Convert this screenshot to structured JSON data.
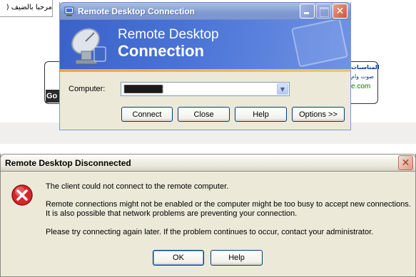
{
  "background_page": {
    "greeting": "مرحبا بالضيف (",
    "google_fragment": "Go",
    "ad_line1": "المناسبات",
    "ad_line2": "صوت وام",
    "ad_line3": "e.com"
  },
  "rdc_window": {
    "title": "Remote Desktop Connection",
    "banner_line1": "Remote Desktop",
    "banner_line2": "Connection",
    "computer_label": "Computer:",
    "computer_value": "xxxxxxxxxxxx",
    "buttons": {
      "connect": "Connect",
      "close": "Close",
      "help": "Help",
      "options": "Options >>"
    }
  },
  "disconnected_dialog": {
    "title": "Remote Desktop Disconnected",
    "message_1": "The client could not connect to the remote computer.",
    "message_2a": "Remote connections might not be enabled or the computer might be too busy to accept new connections.",
    "message_2b": "It is also possible that network problems are preventing your connection.",
    "message_3": "Please try connecting again later. If the problem continues to occur, contact your administrator.",
    "buttons": {
      "ok": "OK",
      "help": "Help"
    }
  },
  "icons": {
    "rdc_title_icon": "remote-desktop-icon",
    "error_icon": "error-icon",
    "close_glyph": "✕"
  },
  "colors": {
    "xp_face": "#ece9d8",
    "rdc_banner_blue": "#4b74d6",
    "banner_stripe_orange": "#f7a23b",
    "error_red": "#d6262a"
  }
}
